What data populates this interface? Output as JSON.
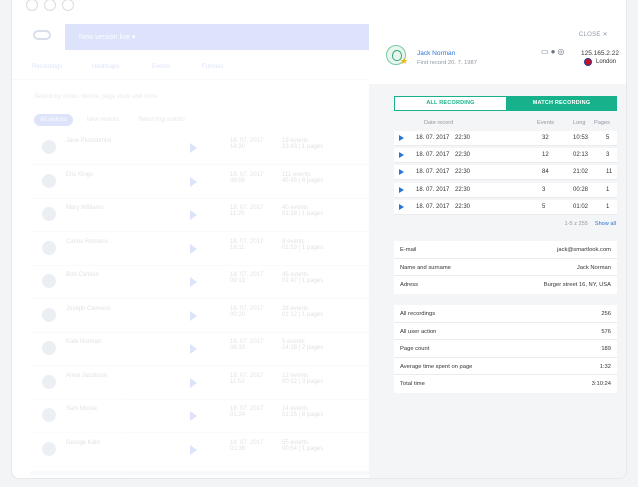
{
  "background_app": {
    "banner": "New version live",
    "tabs": [
      "Recordings",
      "Heatmaps",
      "Events",
      "Funnels"
    ],
    "search_placeholder": "Search by visitor, device, page visits and more",
    "filters": [
      "All visitors",
      "New visitors",
      "Returning visitors"
    ],
    "rows": [
      {
        "name": "Jane Piccolomini",
        "date": "18. 07. 2017",
        "time": "14:30",
        "events": "19 events",
        "meta": "23:43 | 1 pages"
      },
      {
        "name": "Eric Kings",
        "date": "18. 07. 2017",
        "time": "08:56",
        "events": "111 events",
        "meta": "45:45 | 8 pages"
      },
      {
        "name": "Mary Williams",
        "date": "18. 07. 2017",
        "time": "11:25",
        "events": "40 events",
        "meta": "01:28 | 1 pages"
      },
      {
        "name": "Carlos Romano",
        "date": "18. 07. 2017",
        "time": "18:11",
        "events": "9 events",
        "meta": "01:53 | 1 pages"
      },
      {
        "name": "Bob Carlson",
        "date": "18. 07. 2017",
        "time": "09:13",
        "events": "45 events",
        "meta": "01:47 | 1 pages"
      },
      {
        "name": "Joseph Clemens",
        "date": "18. 07. 2017",
        "time": "00:20",
        "events": "28 events",
        "meta": "01:12 | 1 pages"
      },
      {
        "name": "Kate Norman",
        "date": "18. 07. 2017",
        "time": "08:33",
        "events": "5 events",
        "meta": "14:28 | 2 pages"
      },
      {
        "name": "Anna Jacobson",
        "date": "18. 07. 2017",
        "time": "11:52",
        "events": "12 events",
        "meta": "00:12 | 3 pages"
      },
      {
        "name": "Sam Moore",
        "date": "18. 07. 2017",
        "time": "01:24",
        "events": "14 events",
        "meta": "01:25 | 8 pages"
      },
      {
        "name": "George Kato",
        "date": "18. 07. 2017",
        "time": "01:38",
        "events": "55 events",
        "meta": "00:54 | 1 pages"
      }
    ]
  },
  "panel": {
    "close_label": "CLOSE ✕",
    "user_name": "Jack Norman",
    "first_record": "First record 20. 7. 1987",
    "ip": "125.165.2.22",
    "city": "London",
    "tab_all": "ALL RECORDING",
    "tab_match": "MATCH RECORDING",
    "headers": {
      "date": "Date record",
      "events": "Events",
      "long": "Long",
      "pages": "Pages"
    },
    "recordings": [
      {
        "date": "18. 07. 2017",
        "time": "22:30",
        "events": "32",
        "long": "10:53",
        "pages": "5"
      },
      {
        "date": "18. 07. 2017",
        "time": "22:30",
        "events": "12",
        "long": "02:13",
        "pages": "3"
      },
      {
        "date": "18. 07. 2017",
        "time": "22:30",
        "events": "84",
        "long": "21:02",
        "pages": "11"
      },
      {
        "date": "18. 07. 2017",
        "time": "22:30",
        "events": "3",
        "long": "00:28",
        "pages": "1"
      },
      {
        "date": "18. 07. 2017",
        "time": "22:30",
        "events": "5",
        "long": "01:02",
        "pages": "1"
      }
    ],
    "pagination": "1-5 z 255",
    "show_all": "Show all",
    "contact": [
      {
        "label": "E-mail",
        "value": "jack@smartlook.com"
      },
      {
        "label": "Name and surname",
        "value": "Jack Norman"
      },
      {
        "label": "Adress",
        "value": "Burger street 16, NY, USA"
      }
    ],
    "stats": [
      {
        "label": "All recordings",
        "value": "256"
      },
      {
        "label": "All user action",
        "value": "576"
      },
      {
        "label": "Page count",
        "value": "189"
      },
      {
        "label": "Average time spent on page",
        "value": "1:32"
      },
      {
        "label": "Total time",
        "value": "3:10:24"
      }
    ]
  }
}
